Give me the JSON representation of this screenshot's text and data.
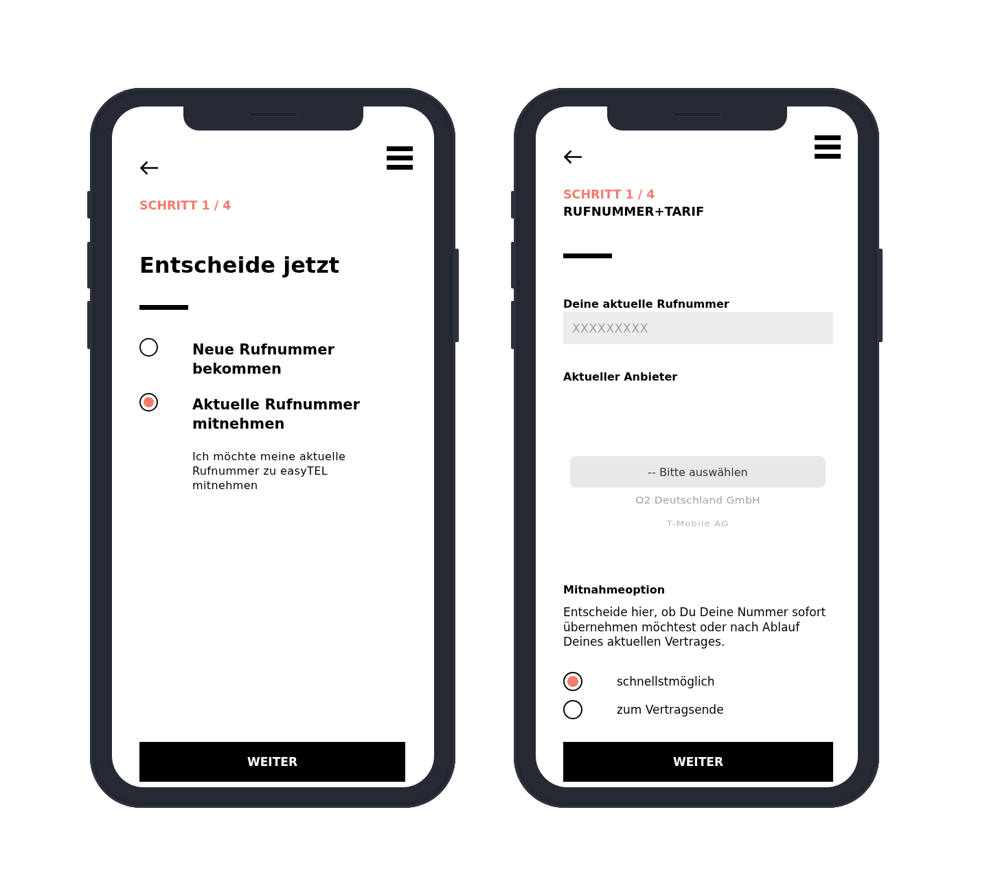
{
  "phones": [
    {
      "kind": "choice",
      "step": "SCHRITT 1 / 4",
      "title": "Entscheide jetzt",
      "options": [
        {
          "label": "Neue Rufnummer bekommen",
          "selected": false
        },
        {
          "label": "Aktuelle Rufnummer mitnehmen",
          "selected": true,
          "description": "Ich möchte meine aktuelle Rufnummer zu easyTEL mitnehmen"
        }
      ],
      "button": "WEITER"
    },
    {
      "kind": "form",
      "step": "SCHRITT 1 / 4",
      "subtitle": "RUFNUMMER+TARIF",
      "phone_field": {
        "label": "Deine aktuelle Rufnummer",
        "placeholder": "XXXXXXXXX"
      },
      "provider": {
        "label": "Aktueller Anbieter",
        "options": [
          {
            "label": "-- Bitte auswählen",
            "selected": true
          },
          {
            "label": "O2 Deutschland GmbH",
            "selected": false
          },
          {
            "label": "T-Mobile AG",
            "selected": false
          }
        ]
      },
      "porting": {
        "label": "Mitnahmeoption",
        "text": "Entscheide hier, ob Du Deine Nummer sofort übernehmen möchtest oder nach Ablauf Deines aktuellen Vertrages.",
        "options": [
          {
            "label": "schnellstmöglich",
            "selected": true
          },
          {
            "label": "zum Vertragsende",
            "selected": false
          }
        ]
      },
      "button": "WEITER"
    }
  ]
}
